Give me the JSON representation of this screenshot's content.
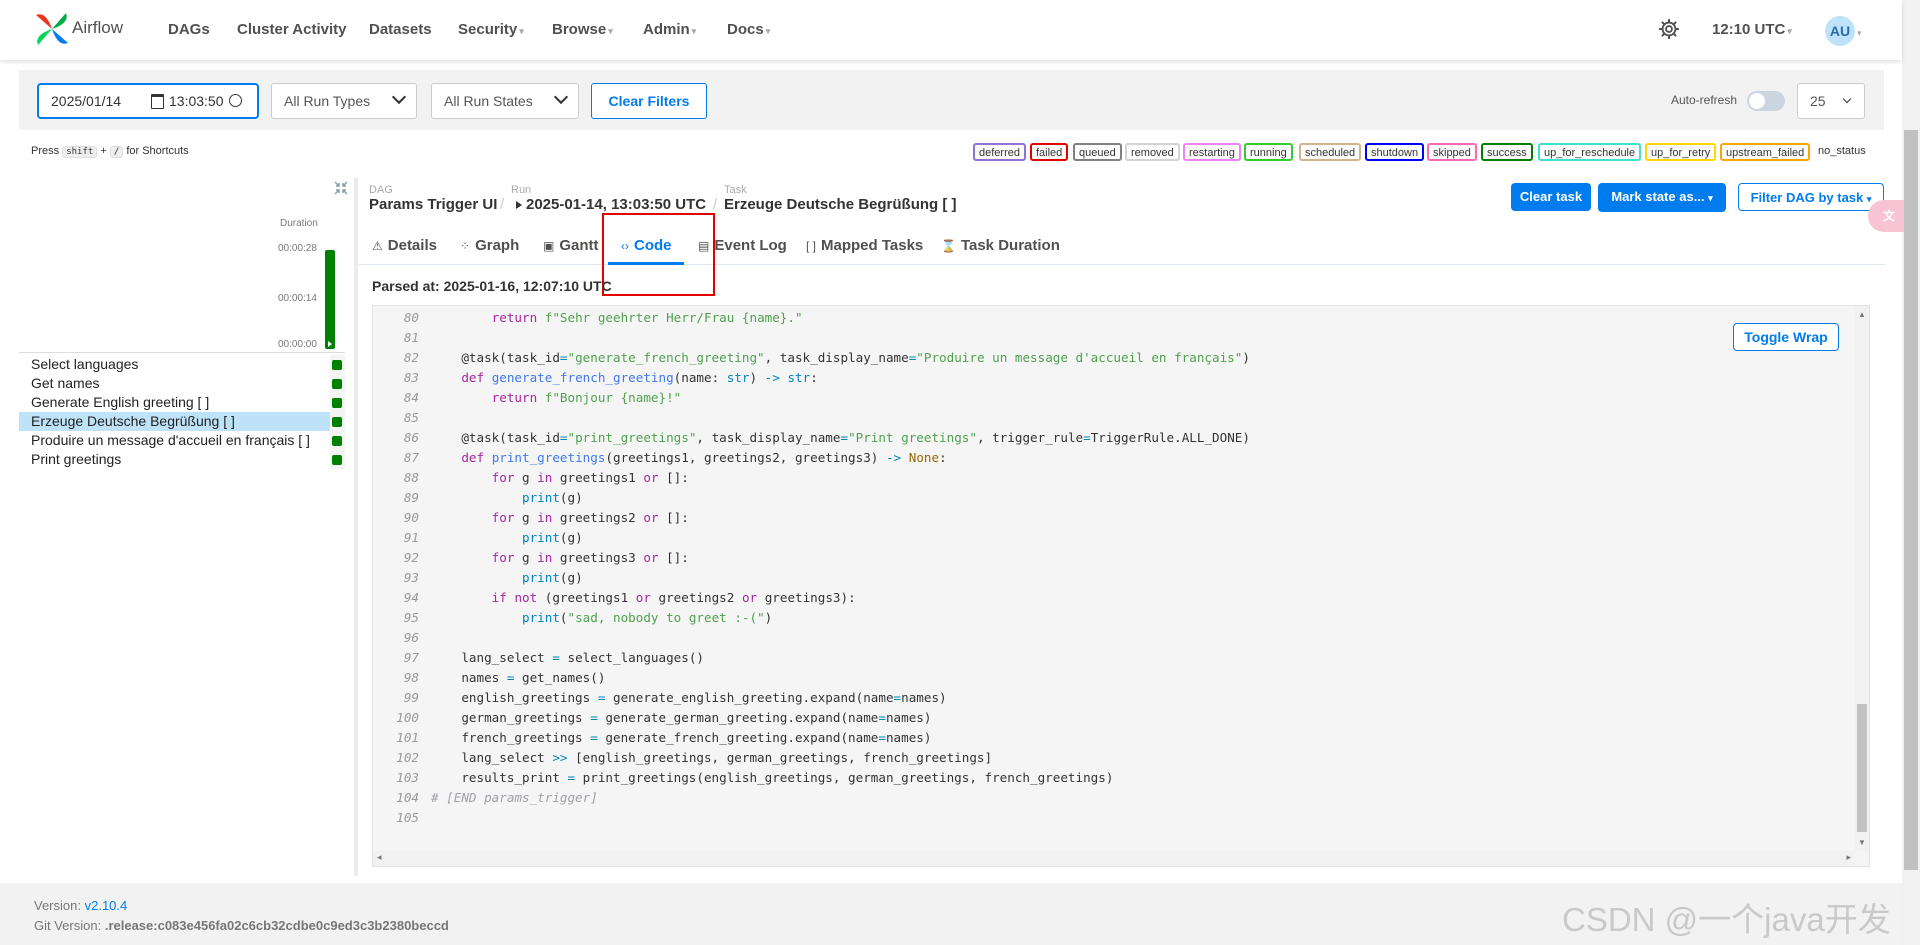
{
  "navbar": {
    "brand": "Airflow",
    "items": [
      {
        "label": "DAGs",
        "dropdown": false
      },
      {
        "label": "Cluster Activity",
        "dropdown": false
      },
      {
        "label": "Datasets",
        "dropdown": false
      },
      {
        "label": "Security",
        "dropdown": true
      },
      {
        "label": "Browse",
        "dropdown": true
      },
      {
        "label": "Admin",
        "dropdown": true
      },
      {
        "label": "Docs",
        "dropdown": true
      }
    ],
    "time": "12:10 UTC",
    "avatar": "AU"
  },
  "filters": {
    "date": "2025/01/14",
    "time": "13:03:50",
    "run_types": "All Run Types",
    "run_states": "All Run States",
    "clear_label": "Clear Filters",
    "auto_refresh_label": "Auto-refresh",
    "page_size": "25"
  },
  "shortcuts": {
    "press": "Press",
    "key1": "shift",
    "plus": "+",
    "key2": "/",
    "suffix": "for Shortcuts"
  },
  "legend": [
    {
      "label": "deferred",
      "color": "#9370db"
    },
    {
      "label": "failed",
      "color": "#e00000"
    },
    {
      "label": "queued",
      "color": "#808080"
    },
    {
      "label": "removed",
      "color": "#d3d3d3"
    },
    {
      "label": "restarting",
      "color": "#ee82ee"
    },
    {
      "label": "running",
      "color": "#32cd32"
    },
    {
      "label": "scheduled",
      "color": "#d2b48c"
    },
    {
      "label": "shutdown",
      "color": "#0000ff"
    },
    {
      "label": "skipped",
      "color": "#ff69b4"
    },
    {
      "label": "success",
      "color": "#008000"
    },
    {
      "label": "up_for_reschedule",
      "color": "#40e0d0"
    },
    {
      "label": "up_for_retry",
      "color": "#ffd700"
    },
    {
      "label": "upstream_failed",
      "color": "#ffa500"
    },
    {
      "label": "no_status",
      "color": "none"
    }
  ],
  "grid": {
    "duration_label": "Duration",
    "durations": [
      "00:00:28",
      "00:00:14",
      "00:00:00"
    ],
    "tasks": [
      "Select languages",
      "Get names",
      "Generate English greeting [ ]",
      "Erzeuge Deutsche Begrüßung [ ]",
      "Produire un message d'accueil en français [ ]",
      "Print greetings"
    ],
    "selected_index": 3
  },
  "header": {
    "dag_small": "DAG",
    "dag": "Params Trigger UI",
    "run_small": "Run",
    "run": "2025-01-14, 13:03:50 UTC",
    "task_small": "Task",
    "task": "Erzeuge Deutsche Begrüßung [ ]",
    "clear_task": "Clear task",
    "mark_state": "Mark state as...",
    "filter_dag": "Filter DAG by task"
  },
  "tabs": [
    "Details",
    "Graph",
    "Gantt",
    "Code",
    "Event Log",
    "Mapped Tasks",
    "Task Duration"
  ],
  "active_tab": "Code",
  "parsed_at": "Parsed at: 2025-01-16, 12:07:10 UTC",
  "toggle_wrap": "Toggle Wrap",
  "code_lines": [
    {
      "n": "80",
      "t": "        return f\"Sehr geehrter Herr/Frau {name}.\""
    },
    {
      "n": "81",
      "t": ""
    },
    {
      "n": "82",
      "t": "    @task(task_id=\"generate_french_greeting\", task_display_name=\"Produire un message d'accueil en français\")"
    },
    {
      "n": "83",
      "t": "    def generate_french_greeting(name: str) -> str:"
    },
    {
      "n": "84",
      "t": "        return f\"Bonjour {name}!\""
    },
    {
      "n": "85",
      "t": ""
    },
    {
      "n": "86",
      "t": "    @task(task_id=\"print_greetings\", task_display_name=\"Print greetings\", trigger_rule=TriggerRule.ALL_DONE)"
    },
    {
      "n": "87",
      "t": "    def print_greetings(greetings1, greetings2, greetings3) -> None:"
    },
    {
      "n": "88",
      "t": "        for g in greetings1 or []:"
    },
    {
      "n": "89",
      "t": "            print(g)"
    },
    {
      "n": "90",
      "t": "        for g in greetings2 or []:"
    },
    {
      "n": "91",
      "t": "            print(g)"
    },
    {
      "n": "92",
      "t": "        for g in greetings3 or []:"
    },
    {
      "n": "93",
      "t": "            print(g)"
    },
    {
      "n": "94",
      "t": "        if not (greetings1 or greetings2 or greetings3):"
    },
    {
      "n": "95",
      "t": "            print(\"sad, nobody to greet :-(\")"
    },
    {
      "n": "96",
      "t": ""
    },
    {
      "n": "97",
      "t": "    lang_select = select_languages()"
    },
    {
      "n": "98",
      "t": "    names = get_names()"
    },
    {
      "n": "99",
      "t": "    english_greetings = generate_english_greeting.expand(name=names)"
    },
    {
      "n": "100",
      "t": "    german_greetings = generate_german_greeting.expand(name=names)"
    },
    {
      "n": "101",
      "t": "    french_greetings = generate_french_greeting.expand(name=names)"
    },
    {
      "n": "102",
      "t": "    lang_select >> [english_greetings, german_greetings, french_greetings]"
    },
    {
      "n": "103",
      "t": "    results_print = print_greetings(english_greetings, german_greetings, french_greetings)"
    },
    {
      "n": "104",
      "t": "# [END params_trigger]"
    },
    {
      "n": "105",
      "t": ""
    }
  ],
  "footer": {
    "version_label": "Version:",
    "version": "v2.10.4",
    "git_label": "Git Version:",
    "git": ".release:c083e456fa02c6cb32cdbe0c9ed3c3b2380beccd"
  },
  "watermark": "CSDN @一个java开发"
}
